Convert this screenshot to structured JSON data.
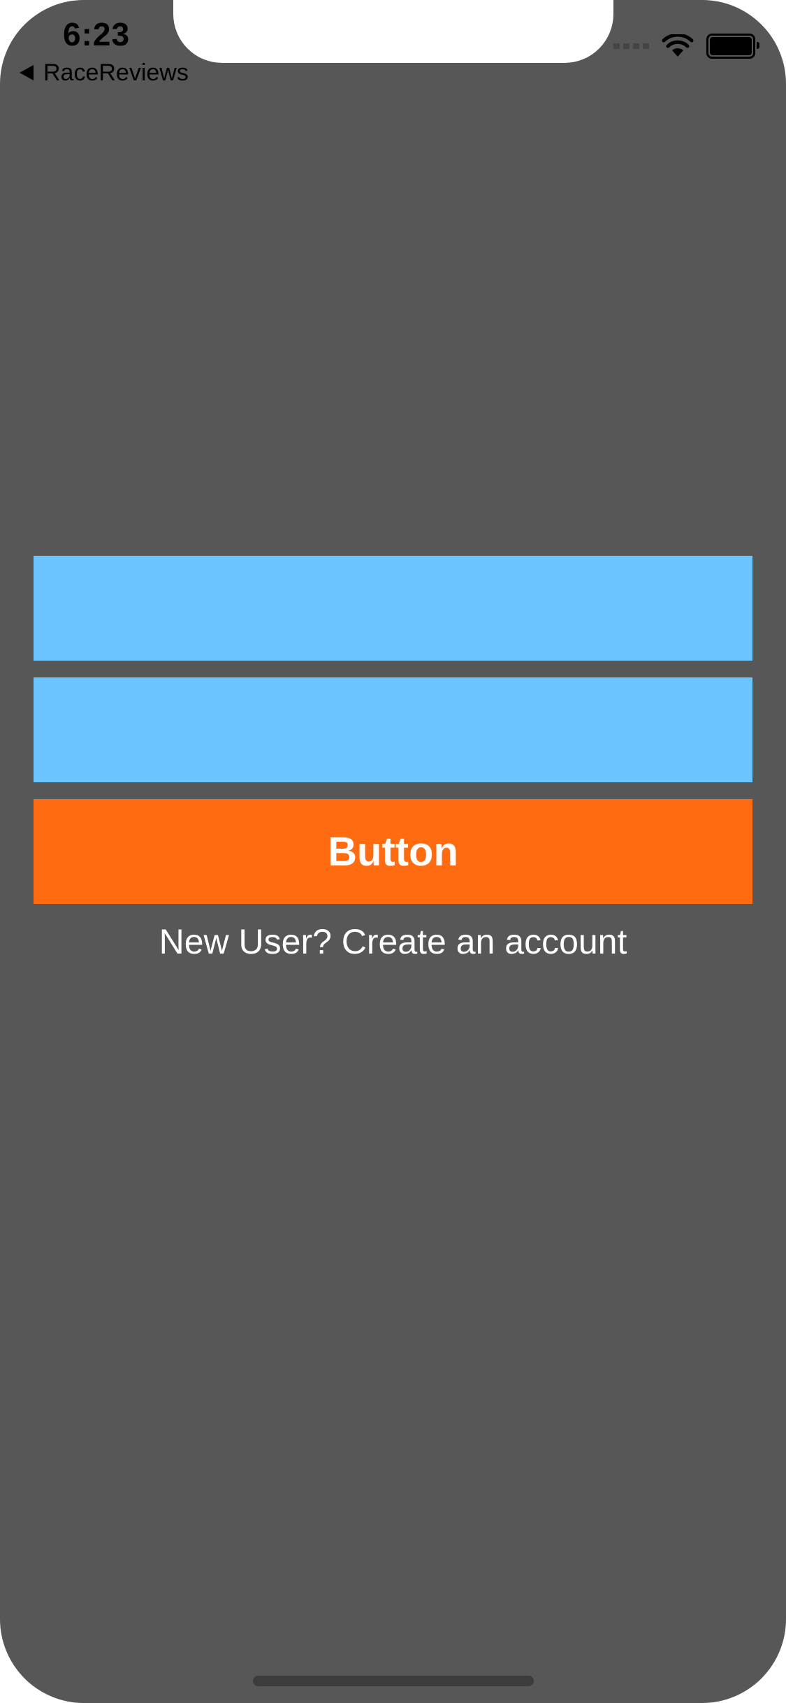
{
  "status_bar": {
    "time": "6:23",
    "back_label": "RaceReviews",
    "icons": [
      "signal-icon",
      "wifi-icon",
      "battery-icon"
    ]
  },
  "form": {
    "username_value": "",
    "password_value": "",
    "submit_label": "Button",
    "signup_label": "New User? Create an account"
  },
  "colors": {
    "background": "#575757",
    "field": "#69c4ff",
    "button": "#ff6b10",
    "button_text": "#ffffff",
    "link_text": "#ffffff"
  }
}
